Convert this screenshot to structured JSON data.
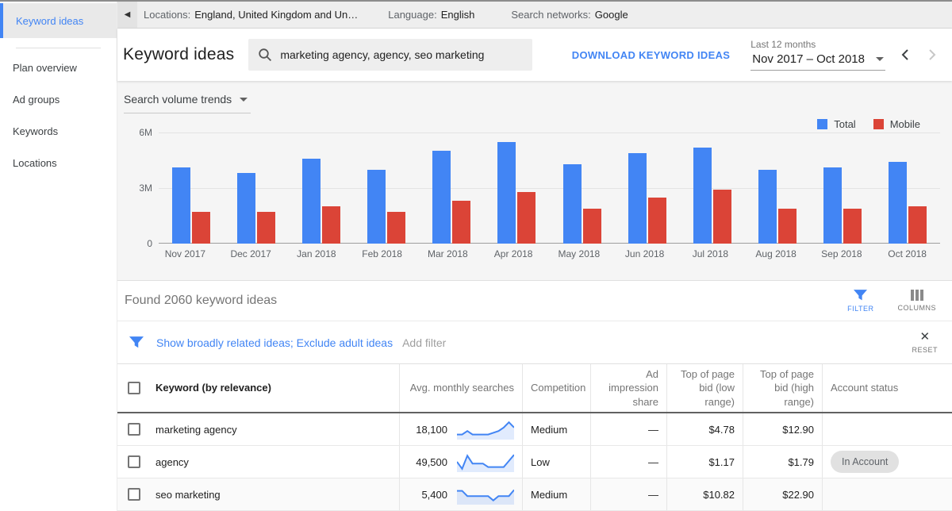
{
  "colors": {
    "accent_blue": "#4285f4",
    "bar_red": "#db4437",
    "link_blue": "#4285f4",
    "gray_text": "#757575"
  },
  "icons": {
    "back_arrow": "◀",
    "reset_close": "✕"
  },
  "sidebar": {
    "active_item": "Keyword ideas",
    "items": [
      "Plan overview",
      "Ad groups",
      "Keywords",
      "Locations"
    ]
  },
  "topbar": {
    "locations_label": "Locations:",
    "locations_value": "England, United Kingdom and Un…",
    "language_label": "Language:",
    "language_value": "English",
    "networks_label": "Search networks:",
    "networks_value": "Google"
  },
  "header": {
    "title": "Keyword ideas",
    "search_value": "marketing agency, agency, seo marketing",
    "download_label": "DOWNLOAD KEYWORD IDEAS",
    "range_caption": "Last 12 months",
    "range_value": "Nov 2017 – Oct 2018"
  },
  "chart_section": {
    "dropdown_label": "Search volume trends",
    "legend": [
      {
        "label": "Total",
        "color": "#4285f4"
      },
      {
        "label": "Mobile",
        "color": "#db4437"
      }
    ]
  },
  "chart_data": {
    "type": "bar",
    "title": "Search volume trends",
    "categories": [
      "Nov 2017",
      "Dec 2017",
      "Jan 2018",
      "Feb 2018",
      "Mar 2018",
      "Apr 2018",
      "May 2018",
      "Jun 2018",
      "Jul 2018",
      "Aug 2018",
      "Sep 2018",
      "Oct 2018"
    ],
    "series": [
      {
        "name": "Total",
        "color": "#4285f4",
        "values": [
          4.1,
          3.8,
          4.6,
          4.0,
          5.0,
          5.5,
          4.3,
          4.9,
          5.2,
          4.0,
          4.1,
          4.4
        ]
      },
      {
        "name": "Mobile",
        "color": "#db4437",
        "values": [
          1.7,
          1.7,
          2.0,
          1.7,
          2.3,
          2.8,
          1.9,
          2.5,
          2.9,
          1.9,
          1.9,
          2.0
        ]
      }
    ],
    "unit": "millions of searches per month",
    "ylim": [
      0,
      6
    ],
    "yticks": [
      "6M",
      "3M",
      "0"
    ],
    "grid": true,
    "legend_position": "top-right"
  },
  "results": {
    "found_text": "Found 2060 keyword ideas",
    "filter_button": "FILTER",
    "columns_button": "COLUMNS"
  },
  "filter_bar": {
    "active_filters": "Show broadly related ideas; Exclude adult ideas",
    "add_filter": "Add filter",
    "reset_label": "RESET"
  },
  "table": {
    "headers": {
      "keyword": "Keyword (by relevance)",
      "avg": "Avg. monthly searches",
      "competition": "Competition",
      "impression": "Ad impression share",
      "bid_low": "Top of page bid (low range)",
      "bid_high": "Top of page bid (high range)",
      "account": "Account status"
    },
    "rows": [
      {
        "keyword": "marketing agency",
        "avg": "18,100",
        "trend": [
          2,
          2,
          4,
          2,
          2,
          2,
          2,
          3,
          4,
          6,
          9,
          6
        ],
        "competition": "Medium",
        "impression": "—",
        "bid_low": "$4.78",
        "bid_high": "$12.90",
        "account": ""
      },
      {
        "keyword": "agency",
        "avg": "49,500",
        "trend": [
          5,
          1,
          8.5,
          4,
          4,
          4,
          2,
          2,
          2,
          2,
          5.5,
          9
        ],
        "competition": "Low",
        "impression": "—",
        "bid_low": "$1.17",
        "bid_high": "$1.79",
        "account": "In Account"
      },
      {
        "keyword": "seo marketing",
        "avg": "5,400",
        "trend": [
          7,
          7,
          4,
          4,
          4,
          4,
          4,
          1.5,
          4,
          4,
          4,
          7.5
        ],
        "competition": "Medium",
        "impression": "—",
        "bid_low": "$10.82",
        "bid_high": "$22.90",
        "account": ""
      }
    ]
  }
}
